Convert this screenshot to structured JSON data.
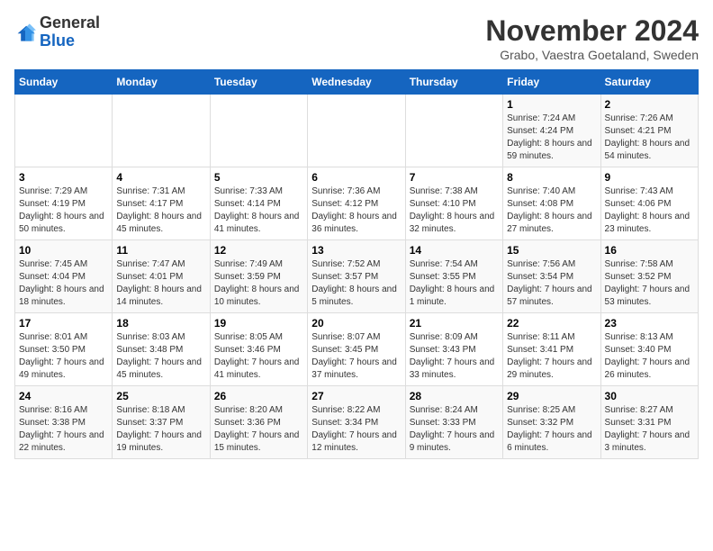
{
  "header": {
    "logo_line1": "General",
    "logo_line2": "Blue",
    "month_title": "November 2024",
    "subtitle": "Grabo, Vaestra Goetaland, Sweden"
  },
  "weekdays": [
    "Sunday",
    "Monday",
    "Tuesday",
    "Wednesday",
    "Thursday",
    "Friday",
    "Saturday"
  ],
  "weeks": [
    [
      {
        "day": "",
        "info": ""
      },
      {
        "day": "",
        "info": ""
      },
      {
        "day": "",
        "info": ""
      },
      {
        "day": "",
        "info": ""
      },
      {
        "day": "",
        "info": ""
      },
      {
        "day": "1",
        "info": "Sunrise: 7:24 AM\nSunset: 4:24 PM\nDaylight: 8 hours and 59 minutes."
      },
      {
        "day": "2",
        "info": "Sunrise: 7:26 AM\nSunset: 4:21 PM\nDaylight: 8 hours and 54 minutes."
      }
    ],
    [
      {
        "day": "3",
        "info": "Sunrise: 7:29 AM\nSunset: 4:19 PM\nDaylight: 8 hours and 50 minutes."
      },
      {
        "day": "4",
        "info": "Sunrise: 7:31 AM\nSunset: 4:17 PM\nDaylight: 8 hours and 45 minutes."
      },
      {
        "day": "5",
        "info": "Sunrise: 7:33 AM\nSunset: 4:14 PM\nDaylight: 8 hours and 41 minutes."
      },
      {
        "day": "6",
        "info": "Sunrise: 7:36 AM\nSunset: 4:12 PM\nDaylight: 8 hours and 36 minutes."
      },
      {
        "day": "7",
        "info": "Sunrise: 7:38 AM\nSunset: 4:10 PM\nDaylight: 8 hours and 32 minutes."
      },
      {
        "day": "8",
        "info": "Sunrise: 7:40 AM\nSunset: 4:08 PM\nDaylight: 8 hours and 27 minutes."
      },
      {
        "day": "9",
        "info": "Sunrise: 7:43 AM\nSunset: 4:06 PM\nDaylight: 8 hours and 23 minutes."
      }
    ],
    [
      {
        "day": "10",
        "info": "Sunrise: 7:45 AM\nSunset: 4:04 PM\nDaylight: 8 hours and 18 minutes."
      },
      {
        "day": "11",
        "info": "Sunrise: 7:47 AM\nSunset: 4:01 PM\nDaylight: 8 hours and 14 minutes."
      },
      {
        "day": "12",
        "info": "Sunrise: 7:49 AM\nSunset: 3:59 PM\nDaylight: 8 hours and 10 minutes."
      },
      {
        "day": "13",
        "info": "Sunrise: 7:52 AM\nSunset: 3:57 PM\nDaylight: 8 hours and 5 minutes."
      },
      {
        "day": "14",
        "info": "Sunrise: 7:54 AM\nSunset: 3:55 PM\nDaylight: 8 hours and 1 minute."
      },
      {
        "day": "15",
        "info": "Sunrise: 7:56 AM\nSunset: 3:54 PM\nDaylight: 7 hours and 57 minutes."
      },
      {
        "day": "16",
        "info": "Sunrise: 7:58 AM\nSunset: 3:52 PM\nDaylight: 7 hours and 53 minutes."
      }
    ],
    [
      {
        "day": "17",
        "info": "Sunrise: 8:01 AM\nSunset: 3:50 PM\nDaylight: 7 hours and 49 minutes."
      },
      {
        "day": "18",
        "info": "Sunrise: 8:03 AM\nSunset: 3:48 PM\nDaylight: 7 hours and 45 minutes."
      },
      {
        "day": "19",
        "info": "Sunrise: 8:05 AM\nSunset: 3:46 PM\nDaylight: 7 hours and 41 minutes."
      },
      {
        "day": "20",
        "info": "Sunrise: 8:07 AM\nSunset: 3:45 PM\nDaylight: 7 hours and 37 minutes."
      },
      {
        "day": "21",
        "info": "Sunrise: 8:09 AM\nSunset: 3:43 PM\nDaylight: 7 hours and 33 minutes."
      },
      {
        "day": "22",
        "info": "Sunrise: 8:11 AM\nSunset: 3:41 PM\nDaylight: 7 hours and 29 minutes."
      },
      {
        "day": "23",
        "info": "Sunrise: 8:13 AM\nSunset: 3:40 PM\nDaylight: 7 hours and 26 minutes."
      }
    ],
    [
      {
        "day": "24",
        "info": "Sunrise: 8:16 AM\nSunset: 3:38 PM\nDaylight: 7 hours and 22 minutes."
      },
      {
        "day": "25",
        "info": "Sunrise: 8:18 AM\nSunset: 3:37 PM\nDaylight: 7 hours and 19 minutes."
      },
      {
        "day": "26",
        "info": "Sunrise: 8:20 AM\nSunset: 3:36 PM\nDaylight: 7 hours and 15 minutes."
      },
      {
        "day": "27",
        "info": "Sunrise: 8:22 AM\nSunset: 3:34 PM\nDaylight: 7 hours and 12 minutes."
      },
      {
        "day": "28",
        "info": "Sunrise: 8:24 AM\nSunset: 3:33 PM\nDaylight: 7 hours and 9 minutes."
      },
      {
        "day": "29",
        "info": "Sunrise: 8:25 AM\nSunset: 3:32 PM\nDaylight: 7 hours and 6 minutes."
      },
      {
        "day": "30",
        "info": "Sunrise: 8:27 AM\nSunset: 3:31 PM\nDaylight: 7 hours and 3 minutes."
      }
    ]
  ]
}
